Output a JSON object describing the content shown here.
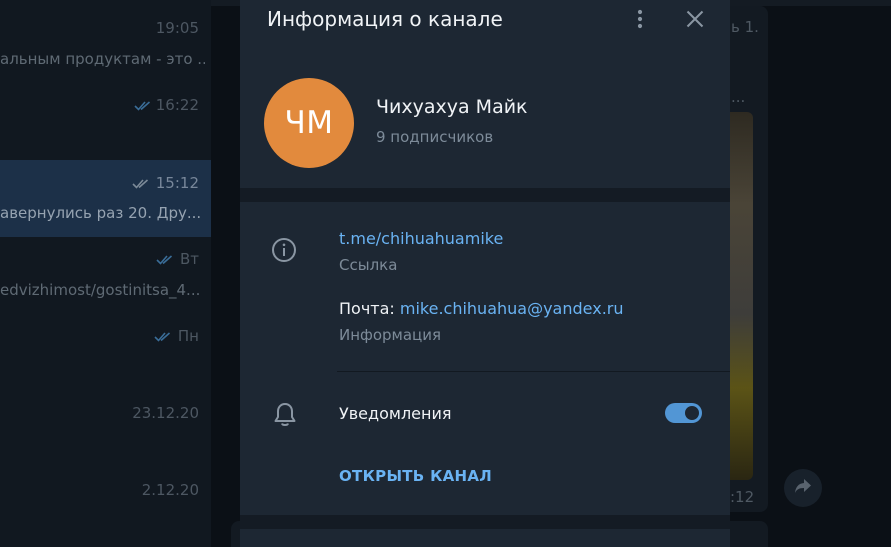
{
  "chat_list": {
    "items": [
      {
        "time": "19:05",
        "preview": "альным продуктам - это ...",
        "check": "none"
      },
      {
        "time": "16:22",
        "preview": "",
        "check": "double"
      },
      {
        "time": "15:12",
        "preview": "авернулись раз 20. Дру...",
        "check": "double",
        "selected": true
      },
      {
        "time": "Вт",
        "preview": "edvizhimost/gostinitsa_4...",
        "check": "double"
      },
      {
        "time": "Пн",
        "preview": "",
        "check": "double"
      },
      {
        "time": "23.12.20",
        "preview": "",
        "check": "none"
      },
      {
        "time": "2.12.20",
        "preview": "",
        "check": "none"
      }
    ]
  },
  "conversation": {
    "fragment_a": "ь 1.",
    "fragment_b": "...",
    "time_fragment": ":12"
  },
  "modal": {
    "title": "Информация о канале",
    "avatar_initials": "ЧМ",
    "avatar_color": "#e28a3d",
    "channel_name": "Чихуахуа Майк",
    "subscribers": "9 подписчиков",
    "link": "t.me/chihuahuamike",
    "link_label": "Ссылка",
    "email_prefix": "Почта: ",
    "email": "mike.chihuahua@yandex.ru",
    "info_label": "Информация",
    "notifications_label": "Уведомления",
    "notifications_on": true,
    "open_channel_label": "ОТКРЫТЬ КАНАЛ"
  },
  "colors": {
    "accent": "#6ab3f3",
    "toggle": "#5296d5",
    "modal_bg": "#1d2733"
  },
  "icons": {
    "more": "more-vertical-icon",
    "close": "close-icon",
    "info": "info-icon",
    "bell": "bell-icon",
    "share": "share-icon",
    "check": "double-check-icon"
  }
}
